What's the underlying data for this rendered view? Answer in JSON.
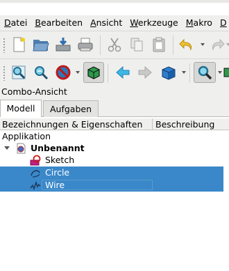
{
  "menu": {
    "items": [
      {
        "label": "Datei",
        "first": "D",
        "rest": "atei"
      },
      {
        "label": "Bearbeiten",
        "first": "B",
        "rest": "earbeiten"
      },
      {
        "label": "Ansicht",
        "first": "A",
        "rest": "nsicht"
      },
      {
        "label": "Werkzeuge",
        "first": "W",
        "rest": "erkzeuge"
      },
      {
        "label": "Makro",
        "first": "M",
        "rest": "akro"
      },
      {
        "label": "D",
        "first": "D",
        "rest": ""
      }
    ]
  },
  "toolbar1": {
    "icons": [
      "new-document-icon",
      "open-folder-icon",
      "save-icon",
      "print-icon",
      "cut-icon",
      "copy-icon",
      "paste-icon",
      "undo-icon",
      "redo-icon"
    ]
  },
  "toolbar2": {
    "icons": [
      "fit-all-icon",
      "fit-selection-icon",
      "draw-style-icon",
      "bounding-box-icon",
      "back-icon",
      "forward-icon",
      "view-cube-icon",
      "zoom-icon"
    ]
  },
  "combo": {
    "title": "Combo-Ansicht",
    "tabs": [
      {
        "label": "Modell",
        "active": true
      },
      {
        "label": "Aufgaben",
        "active": false
      }
    ]
  },
  "tree": {
    "columns": [
      "Bezeichnungen & Eigenschaften",
      "Beschreibung"
    ],
    "section": "Applikation",
    "document": "Unbenannt",
    "items": [
      {
        "label": "Sketch",
        "icon": "sketch-icon",
        "selected": false
      },
      {
        "label": "Circle",
        "icon": "circle-curve-icon",
        "selected": true
      },
      {
        "label": "Wire",
        "icon": "wire-icon",
        "selected": true
      }
    ]
  },
  "colors": {
    "selection": "#3a88c9",
    "toolbar_bg": "#efefee"
  }
}
